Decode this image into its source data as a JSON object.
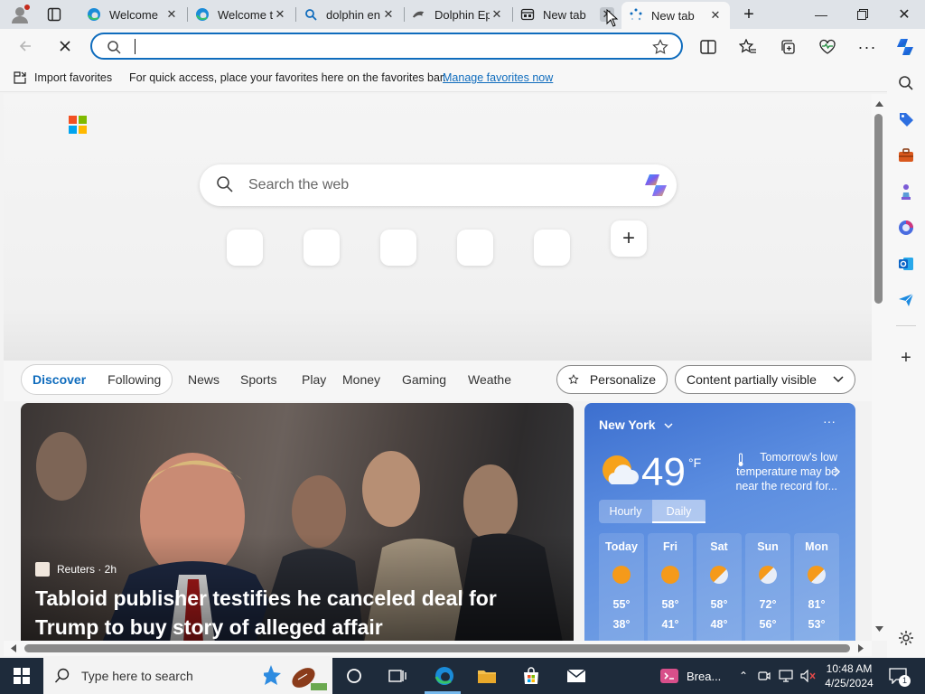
{
  "tabs": [
    {
      "title": "Welcome",
      "icon": "edge-icon"
    },
    {
      "title": "Welcome t",
      "icon": "edge-icon"
    },
    {
      "title": "dolphin en",
      "icon": "search-icon"
    },
    {
      "title": "Dolphin Ep",
      "icon": "dolphin-icon"
    },
    {
      "title": "New tab",
      "icon": "newtab-icon"
    },
    {
      "title": "New tab",
      "icon": "loading-icon"
    }
  ],
  "address": {
    "value": "",
    "placeholder": ""
  },
  "favorites_bar": {
    "import_label": "Import favorites",
    "message": "For quick access, place your favorites here on the favorites bar.",
    "manage_link": "Manage favorites now"
  },
  "newtab": {
    "search_placeholder": "Search the web",
    "feed_tabs": [
      "Discover",
      "Following"
    ],
    "feed_nav": [
      "News",
      "Sports",
      "Play",
      "Money",
      "Gaming",
      "Weathe"
    ],
    "personalize": "Personalize",
    "content_visibility": "Content partially visible"
  },
  "news": {
    "source": "Reuters · 2h",
    "headline": "Tabloid publisher testifies he canceled deal for Trump to buy story of alleged affair"
  },
  "weather": {
    "city": "New York",
    "temp": "49",
    "unit": "°F",
    "note": "Tomorrow's low temperature may be near the record for...",
    "toggle": [
      "Hourly",
      "Daily"
    ],
    "days": [
      {
        "name": "Today",
        "hi": "55°",
        "lo": "38°"
      },
      {
        "name": "Fri",
        "hi": "58°",
        "lo": "41°"
      },
      {
        "name": "Sat",
        "hi": "58°",
        "lo": "48°"
      },
      {
        "name": "Sun",
        "hi": "72°",
        "lo": "56°"
      },
      {
        "name": "Mon",
        "hi": "81°",
        "lo": "53°"
      }
    ]
  },
  "taskbar": {
    "search_placeholder": "Type here to search",
    "app_label": "Brea...",
    "time": "10:48 AM",
    "date": "4/25/2024",
    "notification_count": "1"
  }
}
